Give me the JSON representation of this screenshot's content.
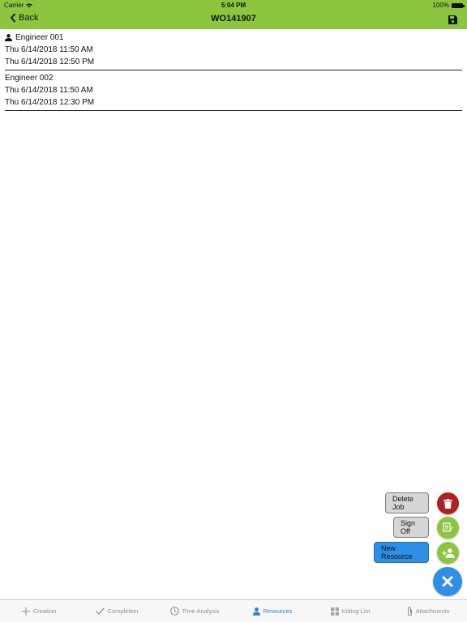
{
  "status_bar": {
    "carrier": "Carrier",
    "time": "5:04 PM",
    "battery": "100%"
  },
  "nav": {
    "back_label": "Back",
    "title": "WO141907"
  },
  "resources": [
    {
      "name": "Engineer 001",
      "start": "Thu 6/14/2018 11:50 AM",
      "end": "Thu 6/14/2018 12:50 PM",
      "has_icon": true
    },
    {
      "name": "Engineer 002",
      "start": "Thu 6/14/2018 11:50 AM",
      "end": "Thu 6/14/2018 12:30 PM",
      "has_icon": false
    }
  ],
  "actions": {
    "delete_job": "Delete Job",
    "sign_off": "Sign Off",
    "new_resource": "New Resource"
  },
  "tabs": [
    {
      "label": "Creation",
      "icon": "plus-icon"
    },
    {
      "label": "Completion",
      "icon": "check-icon"
    },
    {
      "label": "Time Analysis",
      "icon": "clock-icon"
    },
    {
      "label": "Resources",
      "icon": "person-icon",
      "active": true
    },
    {
      "label": "Kitting List",
      "icon": "grid-icon"
    },
    {
      "label": "Attachments",
      "icon": "paperclip-icon"
    }
  ],
  "colors": {
    "brand_green": "#8cc63f",
    "accent_blue": "#2f8fe6",
    "danger_red": "#b01f24"
  }
}
